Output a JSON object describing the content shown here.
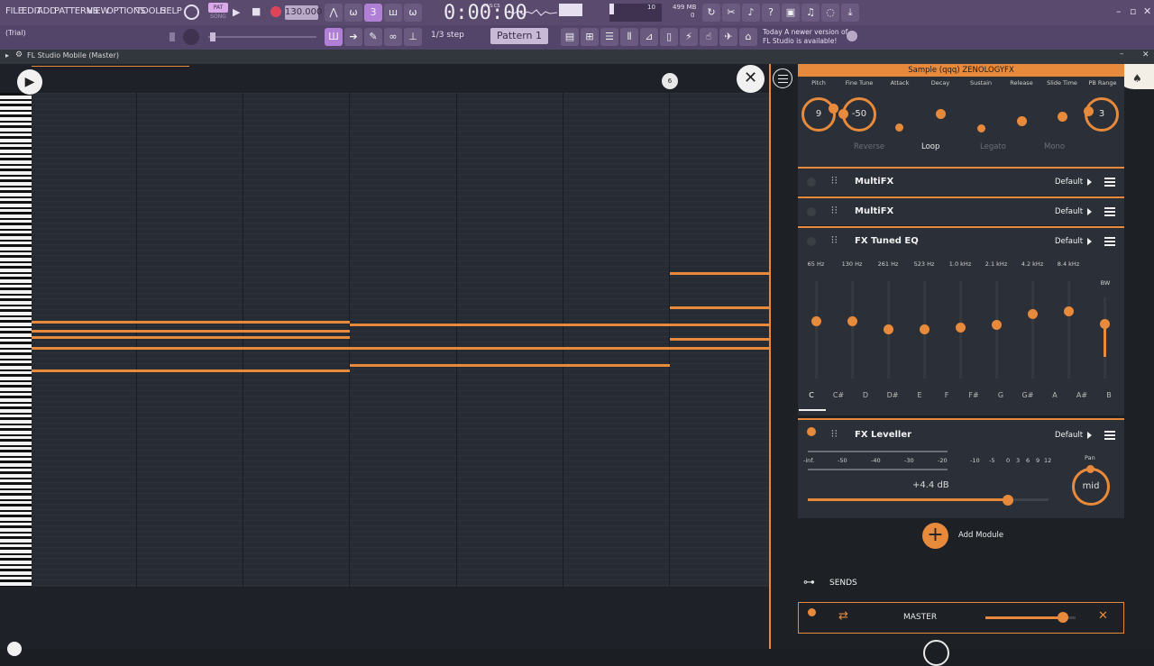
{
  "topbar": {
    "menus": [
      "FILE",
      "EDIT",
      "ADD",
      "PATTERNS",
      "VIEW",
      "OPTIONS",
      "TOOLS",
      "HELP"
    ],
    "pat_label": "PAT",
    "song_label": "SONG",
    "tempo": "130.000",
    "time": "0:00:00",
    "time_unit": "M:S:CS",
    "mem_cpu": "10",
    "mem_mb": "499 MB",
    "mem_zero": "0",
    "trial": "(Trial)",
    "snap": "1/3 step",
    "pattern": "Pattern 1",
    "news_line1": "Today  A newer version of",
    "news_line2": "FL Studio is available!"
  },
  "subbar": {
    "title": "FL Studio Mobile (Master)"
  },
  "roll": {
    "marker": "6"
  },
  "panel": {
    "sample_title": "Sample (qqq) ZENOLOGYFX",
    "params": [
      "Pitch",
      "Fine Tune",
      "Attack",
      "Decay",
      "Sustain",
      "Release",
      "Slide Time",
      "PB Range"
    ],
    "pitch_value": "9",
    "finetune_value": "-50",
    "pbrange_value": "3",
    "options": [
      {
        "label": "Reverse",
        "on": false
      },
      {
        "label": "Loop",
        "on": true
      },
      {
        "label": "Legato",
        "on": false
      },
      {
        "label": "Mono",
        "on": false
      }
    ],
    "modules": [
      {
        "name": "MultiFX",
        "preset": "Default"
      },
      {
        "name": "MultiFX",
        "preset": "Default"
      },
      {
        "name": "FX Tuned EQ",
        "preset": "Default"
      },
      {
        "name": "FX Leveller",
        "preset": "Default"
      }
    ],
    "eq_freqs": [
      "65 Hz",
      "130 Hz",
      "261 Hz",
      "523 Hz",
      "1.0 kHz",
      "2.1 kHz",
      "4.2 kHz",
      "8.4 kHz"
    ],
    "eq_bw": "BW",
    "eq_notes": [
      "C",
      "C#",
      "D",
      "D#",
      "E",
      "F",
      "F#",
      "G",
      "G#",
      "A",
      "A#",
      "B"
    ],
    "leveller_scale": [
      "-inf.",
      "-50",
      "-40",
      "-30",
      "-20",
      "-10",
      "-5",
      "0",
      "3",
      "6",
      "9",
      "12"
    ],
    "leveller_gain": "+4.4 dB",
    "pan_label": "Pan",
    "pan_value": "mid",
    "add_module": "Add Module",
    "sends": "SENDS",
    "master": "MASTER"
  },
  "colors": {
    "accent": "#e88a3c",
    "topbar": "#5a4a6e",
    "panel": "#1d2126",
    "card": "#2b3038"
  }
}
